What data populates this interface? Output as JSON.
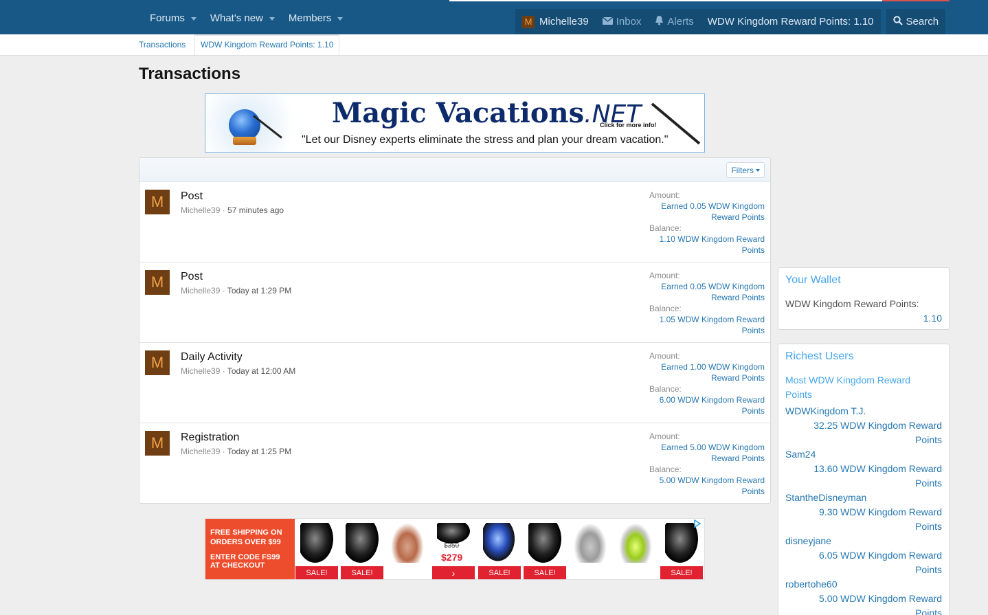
{
  "nav": {
    "items": [
      {
        "label": "Forums"
      },
      {
        "label": "What's new"
      },
      {
        "label": "Members"
      }
    ]
  },
  "userbar": {
    "avatar_letter": "M",
    "username": "Michelle39",
    "inbox": "Inbox",
    "alerts": "Alerts",
    "points": "WDW Kingdom Reward Points: 1.10",
    "search": "Search"
  },
  "breadcrumb": {
    "crumb1": "Transactions",
    "crumb2": "WDW Kingdom Reward Points: 1.10"
  },
  "page": {
    "title": "Transactions"
  },
  "ad_top": {
    "logo": "Magic Vacations",
    "logo_suffix": ".NET",
    "click": "Click for more info!",
    "tagline": "\"Let our Disney experts eliminate the stress and plan your dream vacation.\""
  },
  "filters_label": "Filters",
  "labels": {
    "amount": "Amount:",
    "balance": "Balance:"
  },
  "transactions": [
    {
      "avatar": "M",
      "title": "Post",
      "user": "Michelle39",
      "sep": " · ",
      "time": "57 minutes ago",
      "amount_a": "Earned 0.05 WDW Kingdom",
      "amount_b": "Reward Points",
      "balance_a": "1.10 WDW Kingdom Reward",
      "balance_b": "Points"
    },
    {
      "avatar": "M",
      "title": "Post",
      "user": "Michelle39",
      "sep": " · ",
      "time": "Today at 1:29 PM",
      "amount_a": "Earned 0.05 WDW Kingdom",
      "amount_b": "Reward Points",
      "balance_a": "1.05 WDW Kingdom Reward",
      "balance_b": "Points"
    },
    {
      "avatar": "M",
      "title": "Daily Activity",
      "user": "Michelle39",
      "sep": " · ",
      "time": "Today at 12:00 AM",
      "amount_a": "Earned 1.00 WDW Kingdom",
      "amount_b": "Reward Points",
      "balance_a": "6.00 WDW Kingdom Reward",
      "balance_b": "Points"
    },
    {
      "avatar": "M",
      "title": "Registration",
      "user": "Michelle39",
      "sep": " · ",
      "time": "Today at 1:25 PM",
      "amount_a": "Earned 5.00 WDW Kingdom",
      "amount_b": "Reward Points",
      "balance_a": "5.00 WDW Kingdom Reward",
      "balance_b": "Points"
    }
  ],
  "wallet": {
    "title": "Your Wallet",
    "label": "WDW Kingdom Reward Points:",
    "value": "1.10"
  },
  "richest": {
    "title": "Richest Users",
    "subtitle": "Most WDW Kingdom Reward Points",
    "users": [
      {
        "name": "WDWKingdom T.J.",
        "points_a": "32.25 WDW Kingdom Reward",
        "points_b": "Points"
      },
      {
        "name": "Sam24",
        "points_a": "13.60 WDW Kingdom Reward",
        "points_b": "Points"
      },
      {
        "name": "StantheDisneyman",
        "points_a": "9.30 WDW Kingdom Reward",
        "points_b": "Points"
      },
      {
        "name": "disneyjane",
        "points_a": "6.05 WDW Kingdom Reward",
        "points_b": "Points"
      },
      {
        "name": "robertohe60",
        "points_a": "5.00 WDW Kingdom Reward",
        "points_b": "Points"
      }
    ]
  },
  "ad_bottom": {
    "promo_line1": "FREE SHIPPING ON",
    "promo_line2": "ORDERS OVER $99",
    "promo_line3": "ENTER CODE FS99",
    "promo_line4": "AT CHECKOUT",
    "sale": "SALE!",
    "price_old": "$350",
    "price_new": "$279",
    "arrow": "›"
  },
  "colors": {
    "header_bg": "#185886",
    "link": "#2577b1",
    "accent": "#47a7eb",
    "avatar_bg": "#6f3e12",
    "sale_red": "#e12230"
  }
}
